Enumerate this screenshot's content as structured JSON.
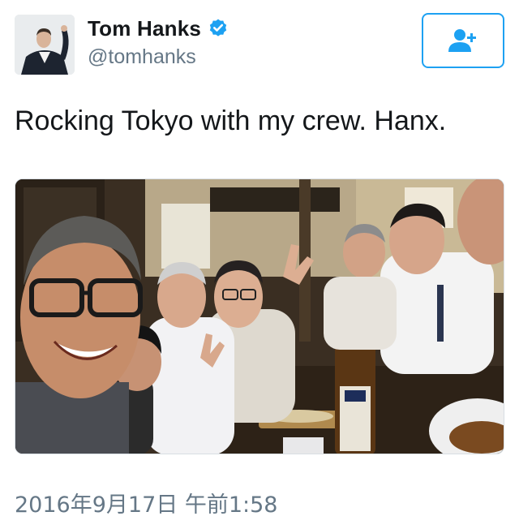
{
  "tweet": {
    "author": {
      "display_name": "Tom Hanks",
      "handle": "@tomhanks",
      "verified": true,
      "avatar_icon": "profile-photo"
    },
    "follow_button": {
      "icon": "add-user-icon"
    },
    "text": "Rocking Tokyo with my crew. Hanx.",
    "media": {
      "type": "photo"
    },
    "timestamp": "2016年9月17日 午前1:58"
  },
  "colors": {
    "brand_blue": "#1da1f2",
    "text_primary": "#14171a",
    "text_secondary": "#657786"
  }
}
